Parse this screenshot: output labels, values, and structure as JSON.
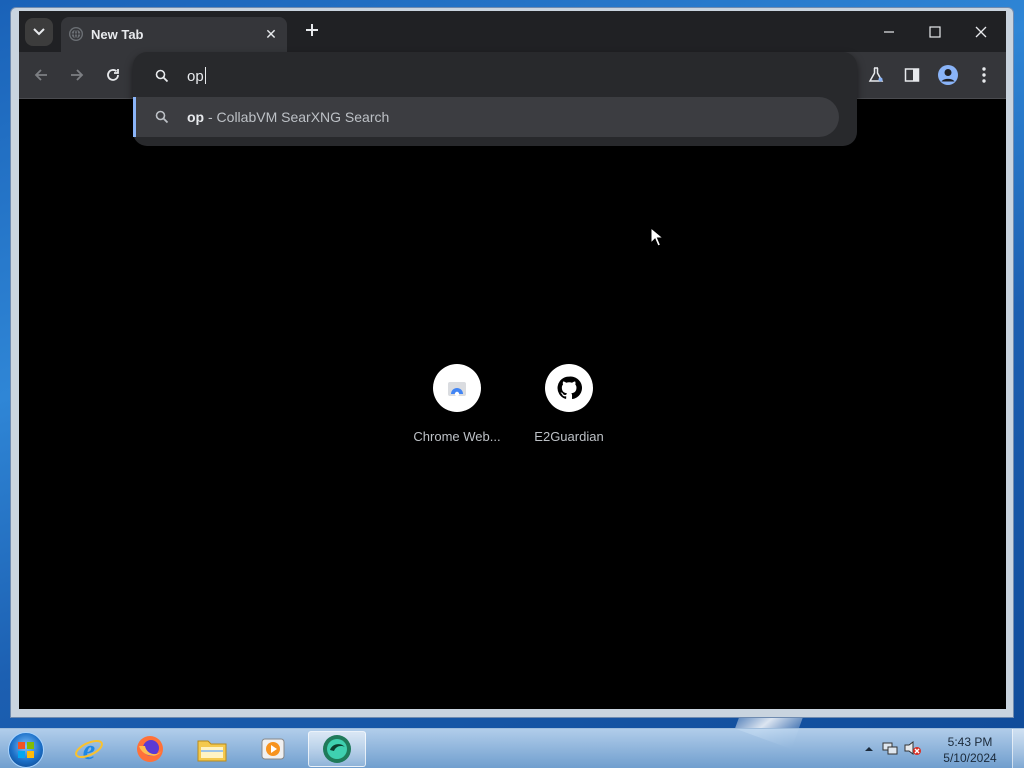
{
  "browser": {
    "tab": {
      "title": "New Tab"
    },
    "omnibox": {
      "value": "op",
      "suggestion": {
        "match": "op",
        "rest": " - CollabVM SearXNG Search"
      }
    },
    "shortcuts": [
      {
        "label": "Chrome Web..."
      },
      {
        "label": "E2Guardian"
      }
    ]
  },
  "taskbar": {
    "clock_time": "5:43 PM",
    "clock_date": "5/10/2024"
  },
  "colors": {
    "accent": "#8ab4f8",
    "toolbar": "#35363a",
    "tabstrip": "#202124"
  }
}
